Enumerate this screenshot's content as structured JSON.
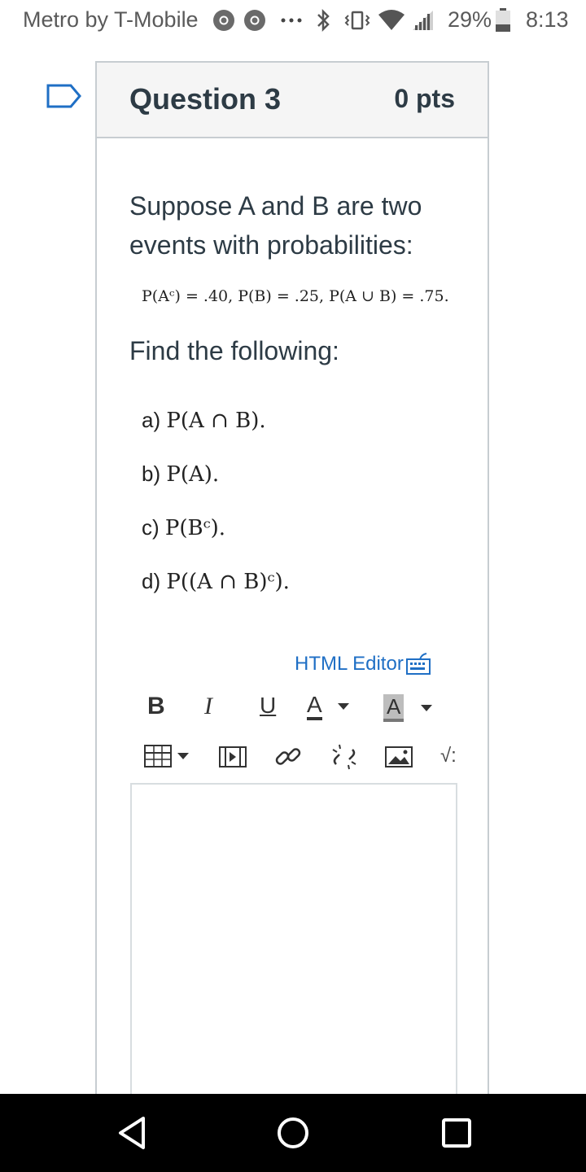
{
  "status_bar": {
    "carrier": "Metro by T-Mobile",
    "battery": "29%",
    "time": "8:13",
    "icons": [
      "chrome-icon",
      "chrome-icon",
      "more-dots-icon",
      "bluetooth-icon",
      "vibrate-icon",
      "wifi-icon",
      "signal-icon",
      "battery-icon"
    ]
  },
  "question": {
    "title": "Question 3",
    "points": "0 pts",
    "intro": "Suppose A and B are two events with probabilities:",
    "formula": "P(Aᶜ) = .40,  P(B) = .25,  P(A ∪ B) = .75.",
    "instruction": "Find the following:",
    "parts": [
      {
        "label": "a)",
        "expr": "P(A ∩ B)."
      },
      {
        "label": "b)",
        "expr": "P(A)."
      },
      {
        "label": "c)",
        "expr": "P(Bᶜ)."
      },
      {
        "label": "d)",
        "expr": "P((A ∩ B)ᶜ)."
      }
    ]
  },
  "editor": {
    "html_editor_label": "HTML Editor",
    "toolbar_row1": {
      "bold": "B",
      "italic": "I",
      "underline": "U",
      "font_color": "A",
      "bg_color": "A"
    },
    "toolbar_row2": [
      "table-icon",
      "media-icon",
      "link-icon",
      "unlink-icon",
      "image-icon",
      "equation-icon"
    ],
    "equation_label": "√:"
  },
  "colors": {
    "link_blue": "#1f6fc5",
    "text_dark": "#2d3b45",
    "header_bg": "#f5f5f5",
    "flag_blue": "#1f6fc5"
  }
}
